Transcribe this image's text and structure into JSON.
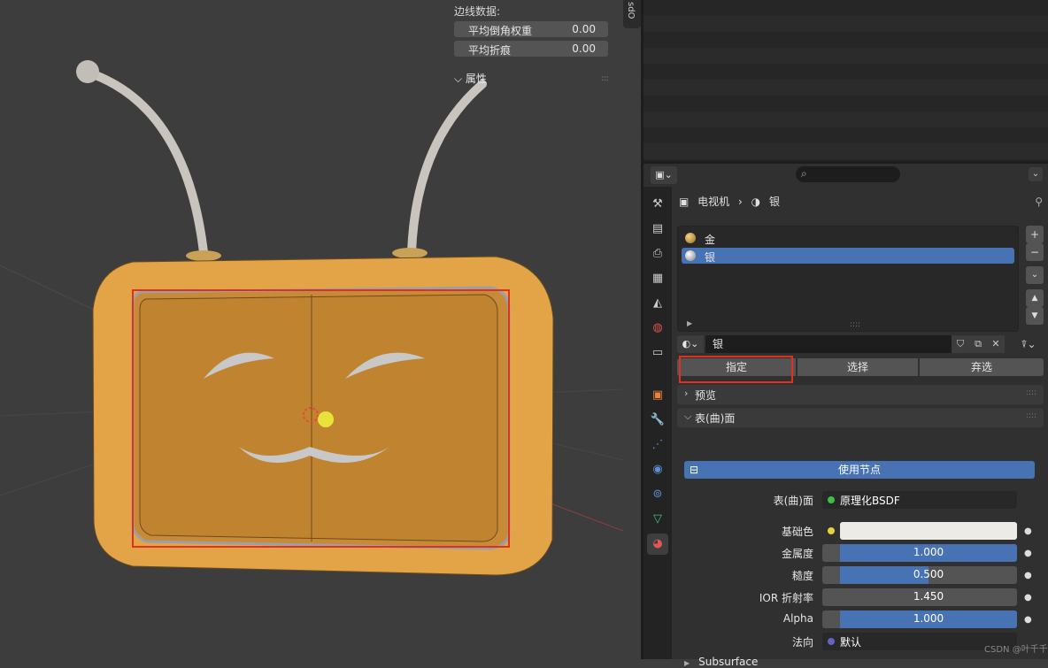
{
  "viewport": {
    "edge_data_title": "边线数据:",
    "fields": [
      {
        "label": "平均倒角权重",
        "value": "0.00"
      },
      {
        "label": "平均折痕",
        "value": "0.00"
      }
    ],
    "section_attributes": "属性",
    "sidebar_tab": "sdO",
    "highlight_color": "#e03020"
  },
  "properties": {
    "editor_type_icon": "properties-icon",
    "search_icon": "search-icon",
    "breadcrumb": {
      "object": "电视机",
      "material": "银"
    },
    "tabs": [
      "tool-icon",
      "render-icon",
      "output-icon",
      "view-layer-icon",
      "scene-icon",
      "world-icon",
      "collection-icon",
      "object-icon",
      "modifier-icon",
      "particles-icon",
      "physics-icon",
      "constraints-icon",
      "data-icon",
      "material-icon"
    ],
    "material_slots": [
      {
        "name": "金",
        "color": "#c9961f",
        "selected": false
      },
      {
        "name": "银",
        "color": "#bfc0c2",
        "selected": true
      }
    ],
    "material_name": "银",
    "buttons": {
      "assign": "指定",
      "select": "选择",
      "deselect": "弃选"
    },
    "panel_preview": "预览",
    "panel_surface": "表(曲)面",
    "use_nodes": "使用节点",
    "surface_label": "表(曲)面",
    "surface_value": "原理化BSDF",
    "base_color_label": "基础色",
    "base_color": "#ecebe6",
    "metallic_label": "金属度",
    "metallic_value": "1.000",
    "metallic_fraction": 1.0,
    "roughness_label": "糙度",
    "roughness_value": "0.500",
    "roughness_fraction": 0.5,
    "ior_label": "IOR 折射率",
    "ior_value": "1.450",
    "alpha_label": "Alpha",
    "alpha_value": "1.000",
    "alpha_fraction": 1.0,
    "normal_label": "法向",
    "normal_value": "默认",
    "subsurface": "Subsurface",
    "accent": "#4772b3"
  },
  "watermark": "CSDN @叶千千"
}
